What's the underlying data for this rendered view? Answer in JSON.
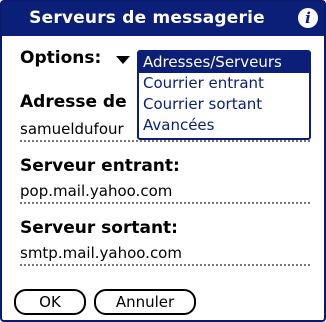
{
  "title": "Serveurs de messagerie",
  "info_icon": "i",
  "options_label": "Options:",
  "options_menu": {
    "items": [
      "Adresses/Serveurs",
      "Courrier entrant",
      "Courrier sortant",
      "Avancées"
    ],
    "selected": "Adresses/Serveurs"
  },
  "address": {
    "label": "Adresse de",
    "value": "samueldufour"
  },
  "incoming": {
    "label": "Serveur entrant:",
    "value": "pop.mail.yahoo.com"
  },
  "outgoing": {
    "label": "Serveur sortant:",
    "value": "smtp.mail.yahoo.com"
  },
  "buttons": {
    "ok": "OK",
    "cancel": "Annuler"
  },
  "colors": {
    "accent": "#0b1e78",
    "background": "#ffffff"
  }
}
